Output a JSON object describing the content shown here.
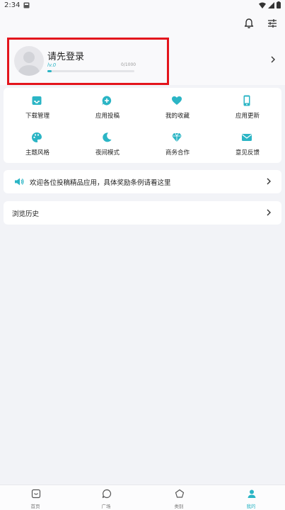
{
  "colors": {
    "accent": "#2bb5c5",
    "highlight_border": "#e3141c"
  },
  "status_bar": {
    "time": "2:34"
  },
  "profile": {
    "title": "请先登录",
    "level": "lv.0",
    "exp": "0/1000",
    "exp_progress": 0.05
  },
  "grid": {
    "items": [
      {
        "label": "下载管理",
        "icon": "download-tray-icon"
      },
      {
        "label": "应用投稿",
        "icon": "submit-plus-icon"
      },
      {
        "label": "我的收藏",
        "icon": "heart-icon"
      },
      {
        "label": "应用更新",
        "icon": "phone-update-icon"
      },
      {
        "label": "主题风格",
        "icon": "palette-icon"
      },
      {
        "label": "夜间模式",
        "icon": "moon-icon"
      },
      {
        "label": "商务合作",
        "icon": "diamond-icon"
      },
      {
        "label": "意见反馈",
        "icon": "mail-icon"
      }
    ]
  },
  "notice": {
    "text": "欢迎各位投稿精品应用，具体奖励条例请看这里"
  },
  "history": {
    "label": "浏览历史"
  },
  "bottom_nav": {
    "items": [
      {
        "label": "首页",
        "icon": "home-tray-icon"
      },
      {
        "label": "广场",
        "icon": "chat-bubble-icon"
      },
      {
        "label": "类别",
        "icon": "pentagon-icon"
      },
      {
        "label": "我的",
        "icon": "person-icon"
      }
    ],
    "active_index": 3
  }
}
